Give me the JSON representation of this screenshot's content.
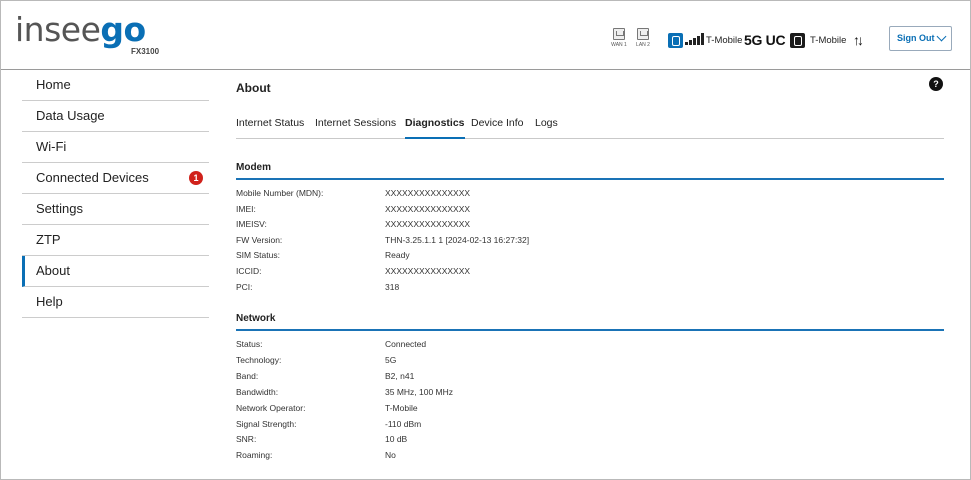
{
  "brand": {
    "logo_part1": "insee",
    "logo_part2": "go",
    "model": "FX3100"
  },
  "status_bar": {
    "ports": [
      {
        "label": "WAN 1"
      },
      {
        "label": "LAN 2"
      }
    ],
    "carrier1": "T-Mobile",
    "network_type": "5G UC",
    "carrier2": "T-Mobile",
    "transfer_arrows": "↑↓",
    "sign_out_label": "Sign Out",
    "icons": [
      "ethernet-port-icon",
      "sim-card-icon",
      "signal-bars-icon",
      "sim-card-icon",
      "data-transfer-icon",
      "chevron-down-icon"
    ]
  },
  "sidebar": {
    "items": [
      {
        "label": "Home"
      },
      {
        "label": "Data Usage"
      },
      {
        "label": "Wi-Fi"
      },
      {
        "label": "Connected Devices",
        "badge": "1"
      },
      {
        "label": "Settings"
      },
      {
        "label": "ZTP"
      },
      {
        "label": "About",
        "active": true
      },
      {
        "label": "Help"
      }
    ]
  },
  "page": {
    "title": "About",
    "help_label": "?",
    "tabs": [
      {
        "label": "Internet Status"
      },
      {
        "label": "Internet Sessions"
      },
      {
        "label": "Diagnostics",
        "active": true
      },
      {
        "label": "Device Info"
      },
      {
        "label": "Logs"
      }
    ]
  },
  "modem": {
    "title": "Modem",
    "rows": [
      {
        "key": "Mobile Number (MDN):",
        "value": "XXXXXXXXXXXXXXX"
      },
      {
        "key": "IMEI:",
        "value": "XXXXXXXXXXXXXXX"
      },
      {
        "key": "IMEISV:",
        "value": "XXXXXXXXXXXXXXX"
      },
      {
        "key": "FW Version:",
        "value": "THN-3.25.1.1 1 [2024-02-13 16:27:32]"
      },
      {
        "key": "SIM Status:",
        "value": "Ready"
      },
      {
        "key": "ICCID:",
        "value": "XXXXXXXXXXXXXXX"
      },
      {
        "key": "PCI:",
        "value": "318"
      }
    ]
  },
  "network": {
    "title": "Network",
    "rows": [
      {
        "key": "Status:",
        "value": "Connected"
      },
      {
        "key": "Technology:",
        "value": "5G"
      },
      {
        "key": "Band:",
        "value": "B2, n41"
      },
      {
        "key": "Bandwidth:",
        "value": "35 MHz, 100 MHz"
      },
      {
        "key": "Network Operator:",
        "value": "T-Mobile"
      },
      {
        "key": "Signal Strength:",
        "value": "-110 dBm"
      },
      {
        "key": "SNR:",
        "value": "10 dB"
      },
      {
        "key": "Roaming:",
        "value": "No"
      }
    ]
  },
  "colors": {
    "accent": "#0a6fb5",
    "badge": "#d0221b",
    "divider": "#1a73b6"
  }
}
